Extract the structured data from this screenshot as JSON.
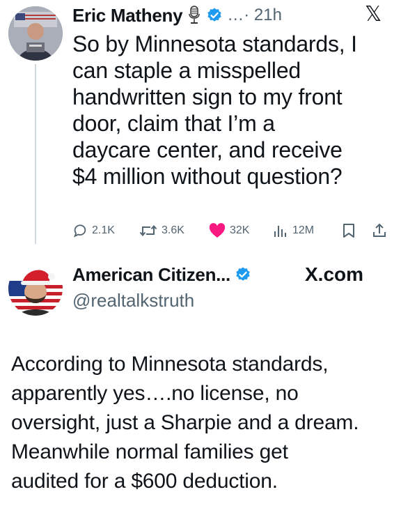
{
  "post1": {
    "author_name": "Eric Matheny",
    "meta": "…· 21h",
    "text": "So by Minnesota standards, I\ncan staple a misspelled\nhandwritten sign to my front\ndoor, claim that I’m a\ndaycare center, and receive\n$4 million without question?",
    "stats": {
      "replies": "2.1K",
      "reposts": "3.6K",
      "likes": "32K",
      "views": "12M"
    },
    "icons": [
      "mic-icon",
      "verified-icon",
      "x-logo-icon",
      "reply-icon",
      "repost-icon",
      "heart-icon",
      "views-icon",
      "bookmark-icon",
      "share-icon"
    ]
  },
  "post2": {
    "author_name": "American Citizen...",
    "handle": "@realtalkstruth",
    "source": "X.com",
    "text": "According to Minnesota standards,\napparently yes….no license, no\noversight, just a Sharpie and a dream.\nMeanwhile normal families get\naudited for a $600 deduction.",
    "icons": [
      "verified-icon"
    ]
  },
  "colors": {
    "text": "#0f1419",
    "secondary": "#536471",
    "verified": "#1d9bf0",
    "like": "#f91880",
    "thread_line": "#cfd9de"
  }
}
